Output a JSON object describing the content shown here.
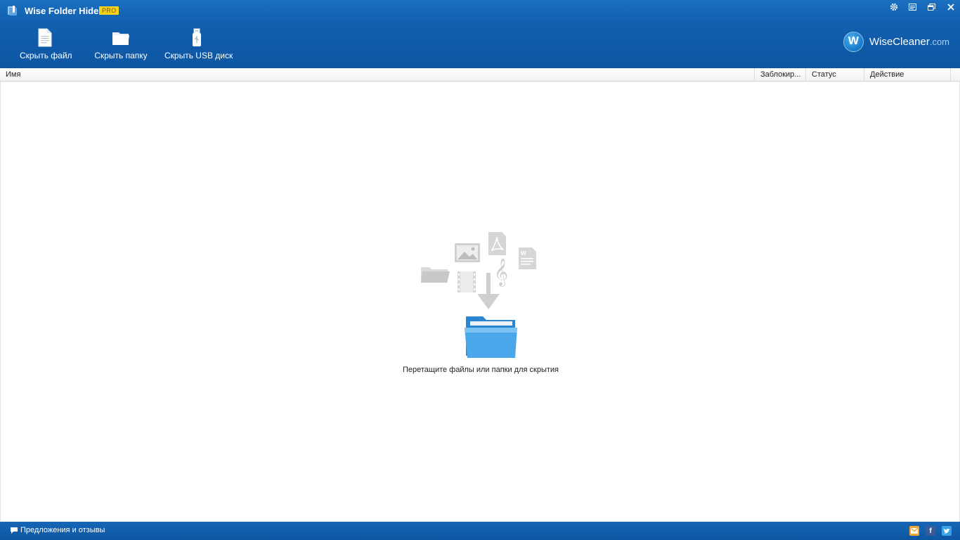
{
  "window": {
    "title": "Wise Folder Hider",
    "badge": "PRO"
  },
  "toolbar": {
    "items": [
      {
        "label": "Скрыть файл",
        "icon": "file-icon"
      },
      {
        "label": "Скрыть папку",
        "icon": "folder-icon"
      },
      {
        "label": "Скрыть USB диск",
        "icon": "usb-icon"
      }
    ]
  },
  "brand": {
    "logo_letter": "W",
    "name": "WiseCleaner",
    "domain": ".com"
  },
  "window_controls": [
    "gear-icon",
    "menu-icon",
    "restore-icon",
    "close-icon"
  ],
  "table": {
    "columns": [
      "Имя",
      "Заблокир...",
      "Статус",
      "Действие"
    ]
  },
  "empty_state": {
    "hint": "Перетащите файлы или папки для скрытия"
  },
  "statusbar": {
    "feedback_label": "Предложения и отзывы",
    "social": [
      "mail-icon",
      "facebook-icon",
      "twitter-icon"
    ]
  },
  "colors": {
    "header_blue": "#125fae",
    "pro_badge": "#f7d21c",
    "folder_blue": "#3a9be0"
  }
}
